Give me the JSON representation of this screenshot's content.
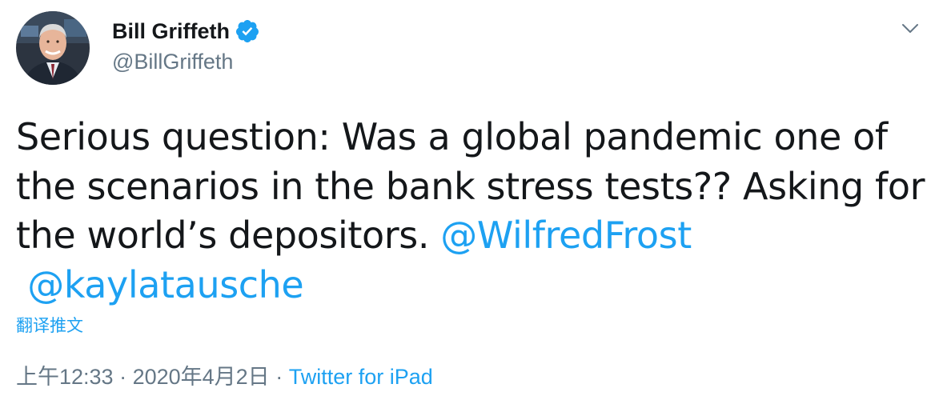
{
  "user": {
    "display_name": "Bill Griffeth",
    "handle": "@BillGriffeth",
    "verified": true,
    "avatar_icon": "profile-photo-avatar"
  },
  "tweet": {
    "line1": "Serious question: Was a global pandemic one of",
    "line2": "the scenarios in the bank stress tests?? Asking for",
    "line3_text": "the world’s depositors. ",
    "mention1": "@WilfredFrost",
    "mention2": "@kaylatausche",
    "translate_label": "翻译推文"
  },
  "meta": {
    "time": "上午12:33",
    "separator1": " · ",
    "date": "2020年4月2日",
    "separator2": " · ",
    "source": "Twitter for iPad"
  },
  "icons": {
    "verified": "verified-badge-icon",
    "menu": "chevron-down-icon"
  },
  "colors": {
    "link": "#1da1f2",
    "secondary_text": "#657786",
    "primary_text": "#14171a"
  }
}
